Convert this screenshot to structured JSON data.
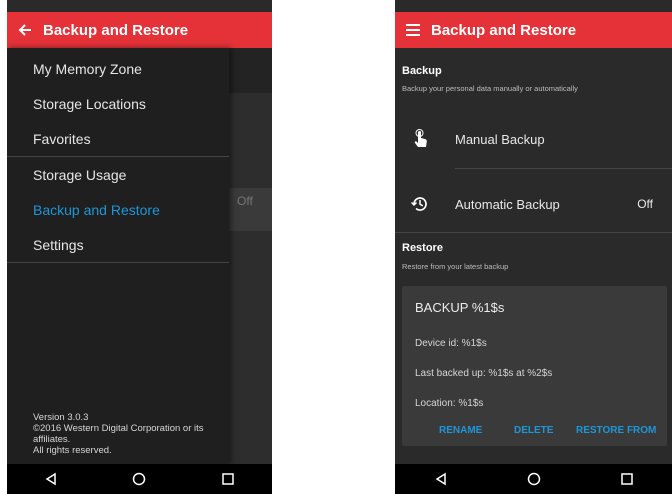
{
  "left_screen": {
    "appbar": {
      "title": "Backup and Restore",
      "nav_icon": "back-arrow-icon"
    },
    "background": {
      "off_value": "Off"
    },
    "drawer": {
      "group1": [
        {
          "label": "My Memory Zone"
        },
        {
          "label": "Storage Locations"
        },
        {
          "label": "Favorites"
        }
      ],
      "group2": [
        {
          "label": "Storage Usage"
        },
        {
          "label": "Backup and Restore",
          "active": true
        },
        {
          "label": "Settings"
        }
      ],
      "footer": {
        "version": "Version 3.0.3",
        "copyright": "©2016 Western Digital Corporation or its",
        "copyright2": "affiliates.",
        "rights": "All rights reserved."
      }
    }
  },
  "right_screen": {
    "appbar": {
      "title": "Backup and Restore",
      "nav_icon": "menu-icon"
    },
    "backup": {
      "title": "Backup",
      "subtitle": "Backup your personal data manually or automatically",
      "manual": {
        "label": "Manual Backup",
        "icon": "touch-icon"
      },
      "automatic": {
        "label": "Automatic Backup",
        "value": "Off",
        "icon": "history-icon"
      }
    },
    "restore": {
      "title": "Restore",
      "subtitle": "Restore from your latest backup",
      "card": {
        "title": "BACKUP %1$s",
        "device": "Device id: %1$s",
        "last": "Last backed up: %1$s at %2$s",
        "location": "Location: %1$s",
        "actions": {
          "rename": "RENAME",
          "delete": "DELETE",
          "restore_from": "RESTORE FROM"
        }
      }
    }
  },
  "colors": {
    "accent_red": "#e53238",
    "accent_blue": "#1e96d8",
    "background": "#2a2a2a"
  },
  "navbar_icons": [
    "back-triangle-icon",
    "home-circle-icon",
    "recents-square-icon"
  ]
}
